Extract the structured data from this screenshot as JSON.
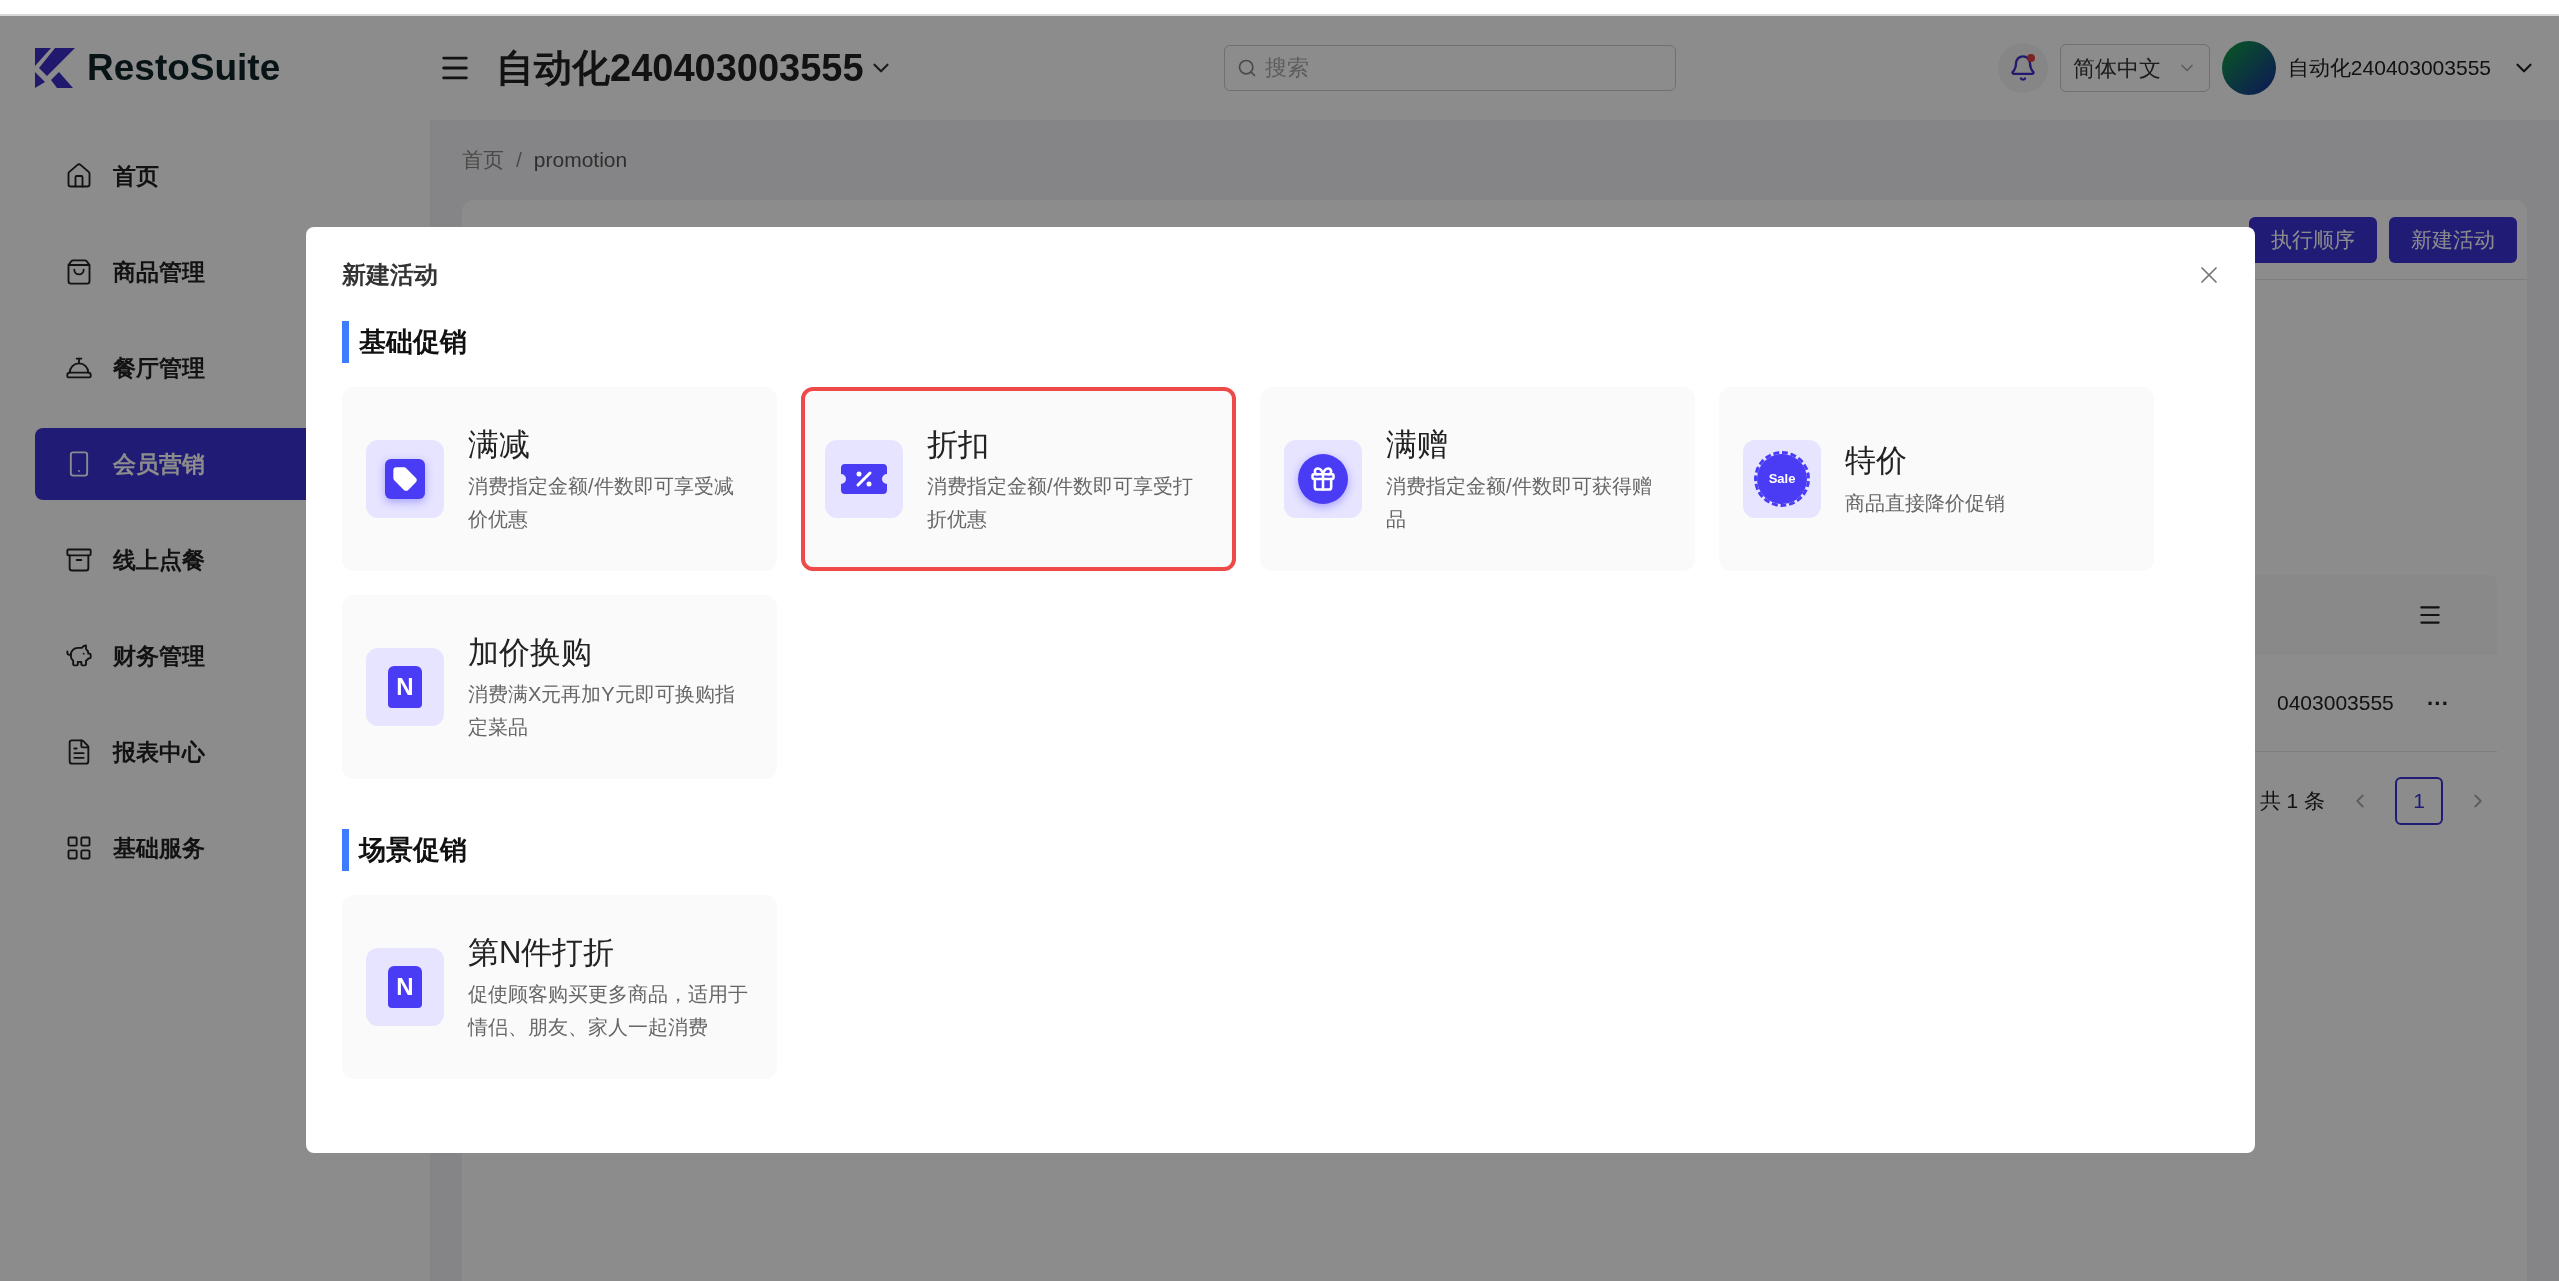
{
  "header": {
    "logo": "RestoSuite",
    "store": "自动化240403003555",
    "search": {
      "placeholder": "搜索"
    },
    "notification": true,
    "language": "简体中文",
    "user": "自动化240403003555"
  },
  "sidebar": {
    "items": [
      {
        "label": "首页",
        "selected": false
      },
      {
        "label": "商品管理",
        "selected": false
      },
      {
        "label": "餐厅管理",
        "selected": false
      },
      {
        "label": "会员营销",
        "selected": true
      },
      {
        "label": "线上点餐",
        "selected": false
      },
      {
        "label": "财务管理",
        "selected": false
      },
      {
        "label": "报表中心",
        "selected": false
      },
      {
        "label": "基础服务",
        "selected": false
      }
    ]
  },
  "breadcrumb": {
    "items": [
      "首页",
      "promotion"
    ],
    "separator": "/"
  },
  "page": {
    "buttons": [
      "执行顺序",
      "新建活动"
    ],
    "table_row": {
      "cell": "0403003555",
      "action": "···"
    },
    "pagination": {
      "total": "共 1 条",
      "pages": [
        {
          "label": "1",
          "selected": true
        }
      ]
    }
  },
  "modal": {
    "title": "新建活动",
    "sections": [
      {
        "title": "基础促销",
        "cards": [
          {
            "title": "满减",
            "description": "消费指定金额/件数即可享受减价优惠",
            "kind": "tag",
            "selected": false
          },
          {
            "title": "折扣",
            "description": "消费指定金额/件数即可享受打折优惠",
            "kind": "ticket",
            "selected": true
          },
          {
            "title": "满赠",
            "description": "消费指定金额/件数即可获得赠品",
            "kind": "gift",
            "selected": false
          },
          {
            "title": "特价",
            "description": "商品直接降价促销",
            "kind": "sale",
            "icon_text": "Sale",
            "selected": false
          },
          {
            "title": "加价换购",
            "description": "消费满X元再加Y元即可换购指定菜品",
            "kind": "n",
            "icon_text": "N",
            "selected": false
          }
        ]
      },
      {
        "title": "场景促销",
        "cards": [
          {
            "title": "第N件打折",
            "description": "促使顾客购买更多商品，适用于情侣、朋友、家人一起消费",
            "kind": "n",
            "icon_text": "N",
            "selected": false
          }
        ]
      }
    ]
  }
}
